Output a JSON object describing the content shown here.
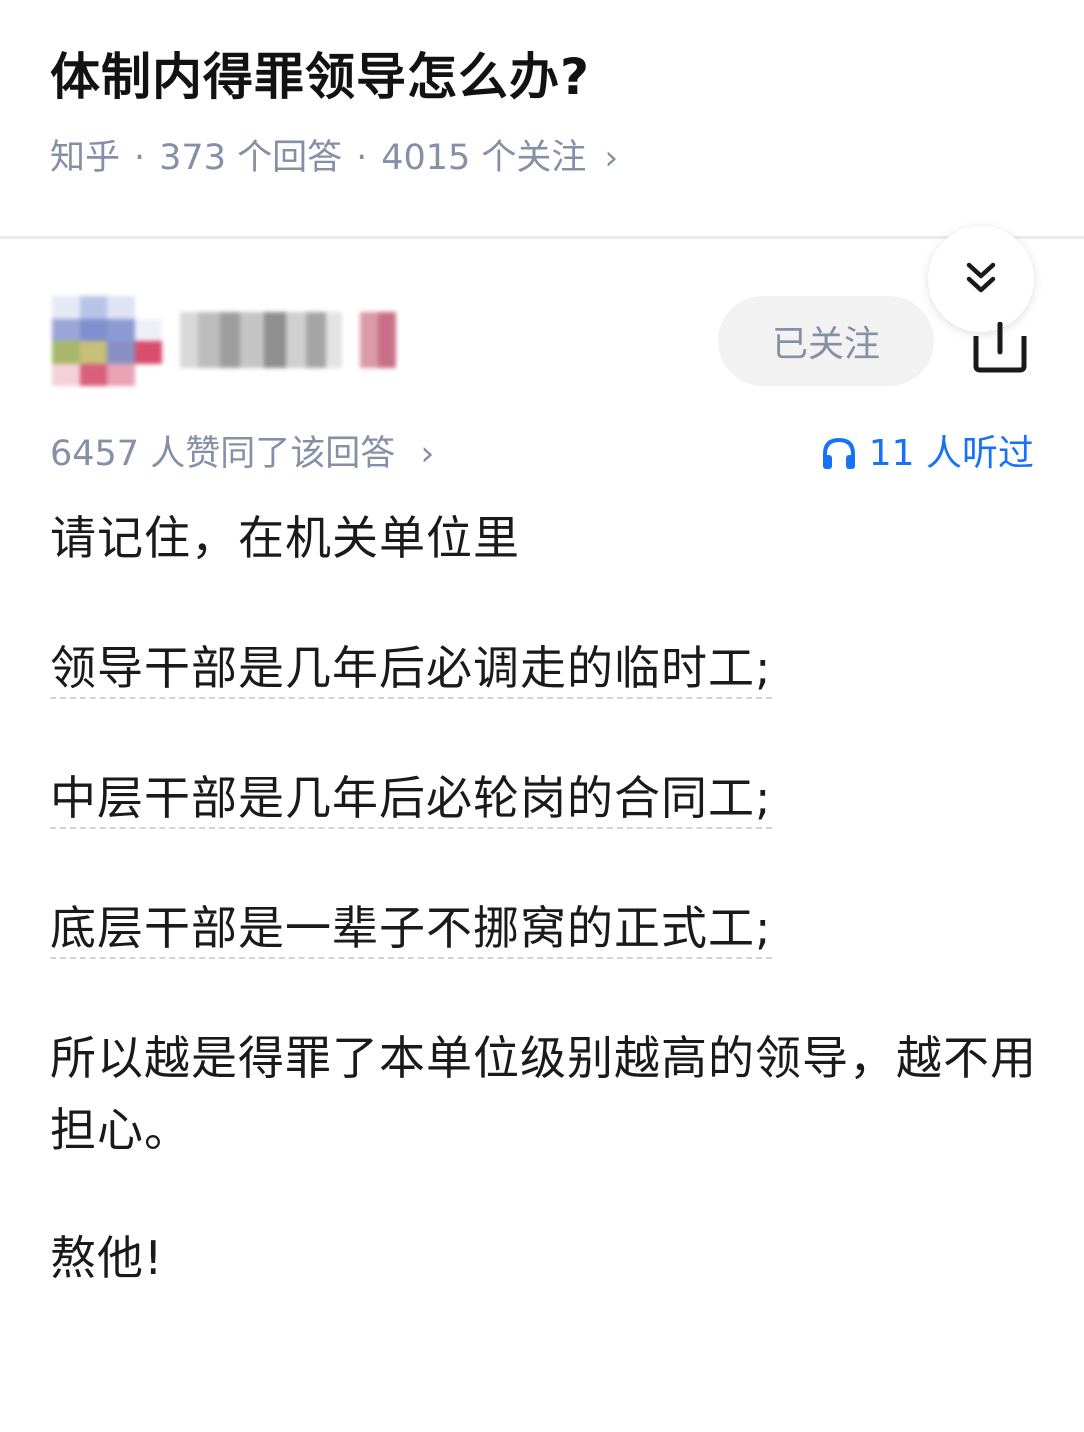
{
  "question": {
    "title": "体制内得罪领导怎么办?",
    "source": "知乎",
    "answer_count": "373 个回答",
    "follow_count": "4015 个关注",
    "meta_chevron": "›"
  },
  "author": {
    "follow_label": "已关注"
  },
  "answer": {
    "upvote_text": "6457 人赞同了该回答",
    "upvote_chevron": "›",
    "listen_text": "11 人听过",
    "paragraphs": [
      "请记住，在机关单位里",
      "领导干部是几年后必调走的临时工;",
      "中层干部是几年后必轮岗的合同工;",
      "底层干部是一辈子不挪窝的正式工;",
      "所以越是得罪了本单位级别越高的领导，越不用担心。",
      "熬他!"
    ]
  },
  "icons": {
    "collapse": "double-chevron-down-icon",
    "share": "share-icon",
    "listen": "headphones-icon"
  },
  "colors": {
    "meta_gray": "#8590a6",
    "accent_blue": "#1772f6",
    "text": "#1a1a1a",
    "button_bg": "#f2f2f2"
  }
}
